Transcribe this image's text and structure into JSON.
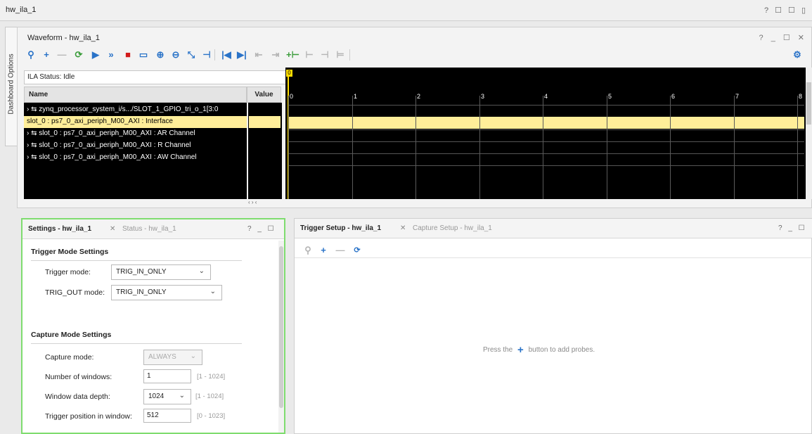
{
  "window": {
    "title": "hw_ila_1",
    "controls": "? ☐ ☐ ▯"
  },
  "sidetab": {
    "label": "Dashboard Options"
  },
  "waveform": {
    "title": "Waveform - hw_ila_1",
    "controls": "? _ ☐ ✕",
    "status": "ILA Status: Idle",
    "columns": {
      "name": "Name",
      "value": "Value"
    },
    "rows": [
      {
        "label": "› ⇆ zynq_processor_system_i/s.../SLOT_1_GPIO_tri_o_1[3:0",
        "selected": false
      },
      {
        "label": "slot_0 : ps7_0_axi_periph_M00_AXI : Interface",
        "selected": true
      },
      {
        "label": "› ⇆ slot_0 : ps7_0_axi_periph_M00_AXI : AR Channel",
        "selected": false
      },
      {
        "label": "› ⇆ slot_0 : ps7_0_axi_periph_M00_AXI : R Channel",
        "selected": false
      },
      {
        "label": "› ⇆ slot_0 : ps7_0_axi_periph_M00_AXI : AW Channel",
        "selected": false
      }
    ],
    "ticks": [
      "0",
      "1",
      "2",
      "3",
      "4",
      "5",
      "6",
      "7",
      "8"
    ],
    "cursor_label": "0",
    "scroll_left": "‹   › ‹"
  },
  "settings": {
    "tab_active": "Settings - hw_ila_1",
    "tab_inactive": "Status - hw_ila_1",
    "controls": "? _ ☐",
    "trigger_section": "Trigger Mode Settings",
    "trigger_mode_label": "Trigger mode:",
    "trigger_mode_value": "TRIG_IN_ONLY",
    "trig_out_label": "TRIG_OUT mode:",
    "trig_out_value": "TRIG_IN_ONLY",
    "capture_section": "Capture Mode Settings",
    "capture_mode_label": "Capture mode:",
    "capture_mode_value": "ALWAYS",
    "num_windows_label": "Number of windows:",
    "num_windows_value": "1",
    "num_windows_range": "[1 - 1024]",
    "window_depth_label": "Window data depth:",
    "window_depth_value": "1024",
    "window_depth_range": "[1 - 1024]",
    "trigger_pos_label": "Trigger position in window:",
    "trigger_pos_value": "512",
    "trigger_pos_range": "[0 - 1023]"
  },
  "trigger_setup": {
    "tab_active": "Trigger Setup - hw_ila_1",
    "tab_inactive": "Capture Setup - hw_ila_1",
    "controls": "? _ ☐",
    "empty_prefix": "Press the",
    "empty_suffix": "button to add probes."
  },
  "colors": {
    "accent": "#2a73c8",
    "selection": "#ffee99",
    "panel_focus": "#7fdc6f",
    "wave_bg": "#000000"
  }
}
